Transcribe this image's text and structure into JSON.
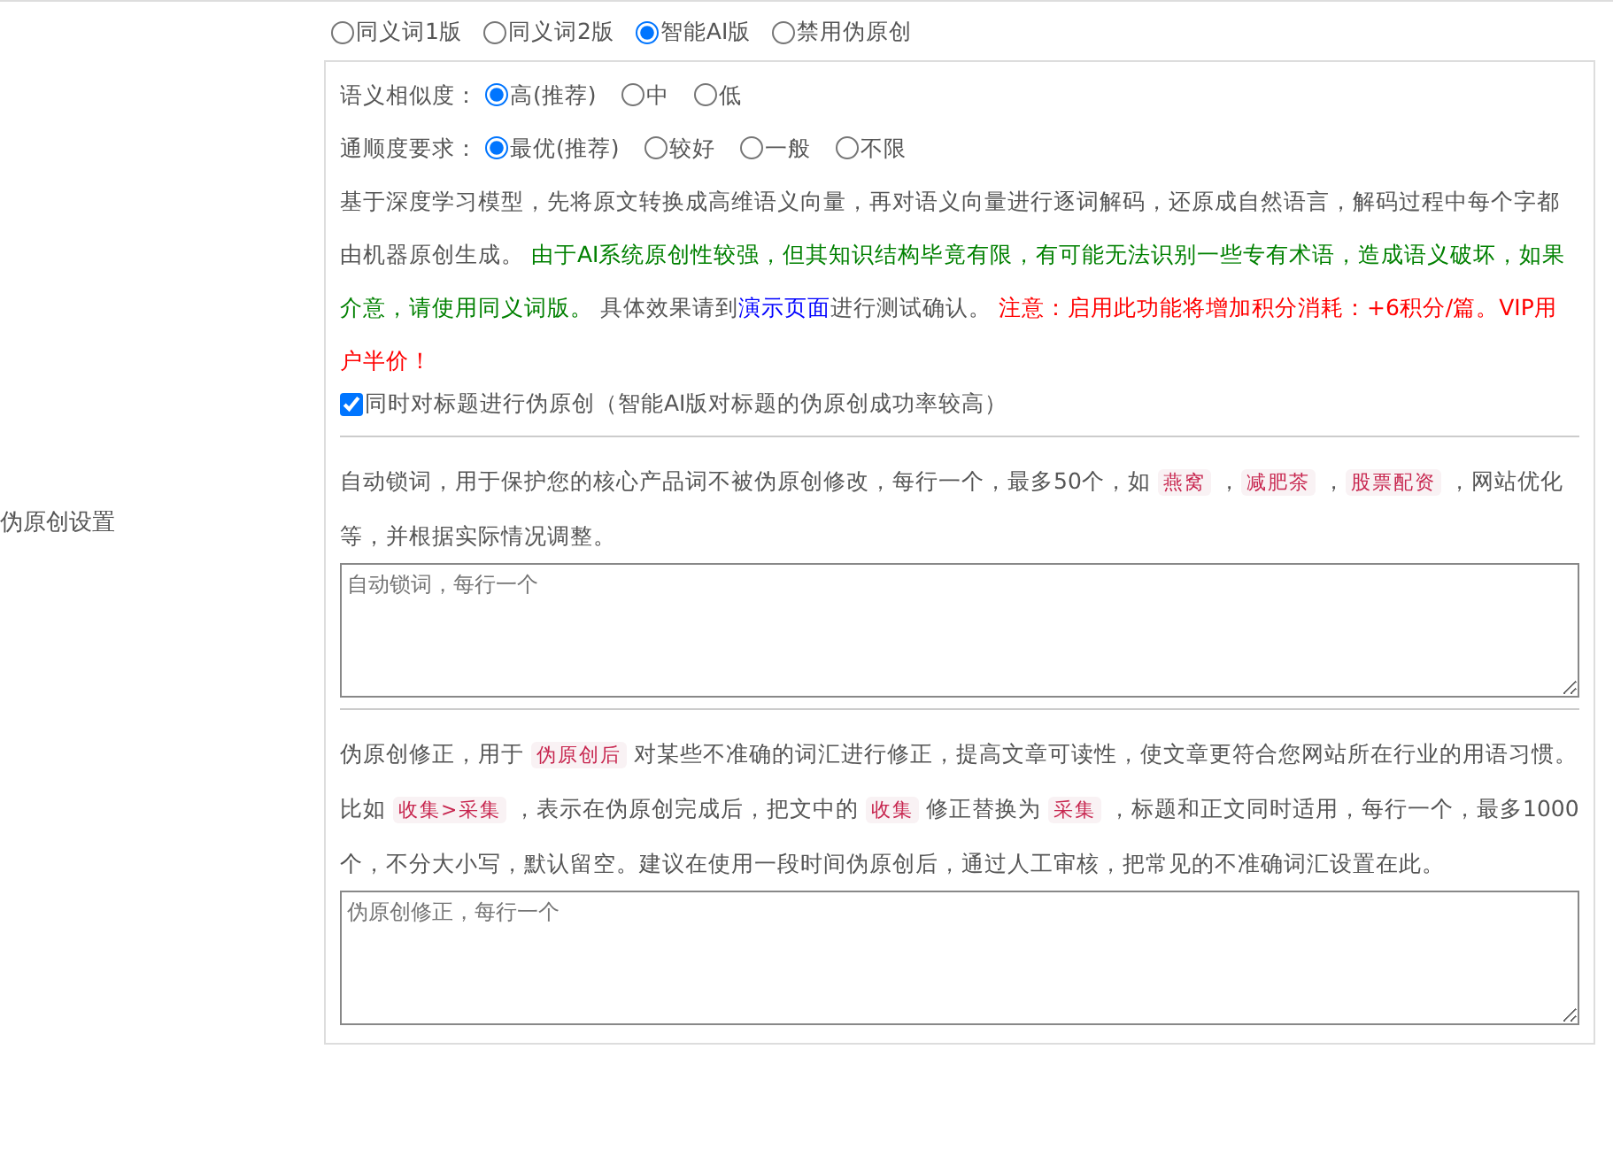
{
  "side_label": "伪原创设置",
  "versions": [
    {
      "label": "同义词1版",
      "selected": false
    },
    {
      "label": "同义词2版",
      "selected": false
    },
    {
      "label": "智能AI版",
      "selected": true
    },
    {
      "label": "禁用伪原创",
      "selected": false
    }
  ],
  "similarity": {
    "label": "语义相似度：",
    "options": [
      {
        "label": "高(推荐)",
        "selected": true
      },
      {
        "label": "中",
        "selected": false
      },
      {
        "label": "低",
        "selected": false
      }
    ]
  },
  "fluency": {
    "label": "通顺度要求：",
    "options": [
      {
        "label": "最优(推荐)",
        "selected": true
      },
      {
        "label": "较好",
        "selected": false
      },
      {
        "label": "一般",
        "selected": false
      },
      {
        "label": "不限",
        "selected": false
      }
    ]
  },
  "ai_description": [
    {
      "kind": "text",
      "text": "基于深度学习模型，先将原文转换成高维语义向量，再对语义向量进行逐词解码，还原成自然语言，解码过程中每个字都由机器原创生成。 "
    },
    {
      "kind": "green",
      "text": "由于AI系统原创性较强，但其知识结构毕竟有限，有可能无法识别一些专有术语，造成语义破坏，如果介意，请使用同义词版。"
    },
    {
      "kind": "text",
      "text": " 具体效果请到"
    },
    {
      "kind": "link",
      "text": "演示页面"
    },
    {
      "kind": "text",
      "text": "进行测试确认。 "
    },
    {
      "kind": "red",
      "text": "注意：启用此功能将增加积分消耗：+6积分/篇。VIP用户半价！"
    }
  ],
  "title_option": {
    "label": "同时对标题进行伪原创（智能AI版对标题的伪原创成功率较高）",
    "checked": true
  },
  "lock_words": {
    "description": [
      {
        "kind": "text",
        "text": "自动锁词，用于保护您的核心产品词不被伪原创修改，每行一个，最多50个，如 "
      },
      {
        "kind": "code",
        "text": "燕窝"
      },
      {
        "kind": "text",
        "text": " ，"
      },
      {
        "kind": "code",
        "text": "减肥茶"
      },
      {
        "kind": "text",
        "text": " ，"
      },
      {
        "kind": "code",
        "text": "股票配资"
      },
      {
        "kind": "text",
        "text": " ，网站优化等，并根据实际情况调整。"
      }
    ],
    "placeholder": "自动锁词，每行一个"
  },
  "correction": {
    "description": [
      {
        "kind": "text",
        "text": "伪原创修正，用于 "
      },
      {
        "kind": "code",
        "text": "伪原创后"
      },
      {
        "kind": "text",
        "text": " 对某些不准确的词汇进行修正，提高文章可读性，使文章更符合您网站所在行业的用语习惯。比如 "
      },
      {
        "kind": "code",
        "text": "收集>采集"
      },
      {
        "kind": "text",
        "text": " ，表示在伪原创完成后，把文中的 "
      },
      {
        "kind": "code",
        "text": "收集"
      },
      {
        "kind": "text",
        "text": " 修正替换为 "
      },
      {
        "kind": "code",
        "text": "采集"
      },
      {
        "kind": "text",
        "text": " ，标题和正文同时适用，每行一个，最多1000个，不分大小写，默认留空。建议在使用一段时间伪原创后，通过人工审核，把常见的不准确词汇设置在此。"
      }
    ],
    "placeholder": "伪原创修正，每行一个"
  }
}
